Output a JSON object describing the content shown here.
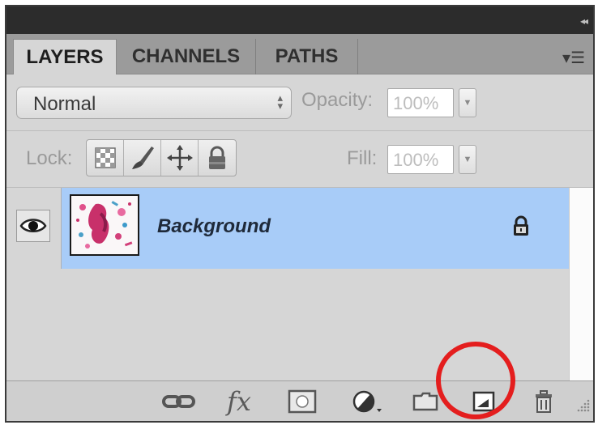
{
  "panel": {
    "tabs": [
      {
        "label": "LAYERS",
        "active": true
      },
      {
        "label": "CHANNELS",
        "active": false
      },
      {
        "label": "PATHS",
        "active": false
      }
    ]
  },
  "options": {
    "blend_mode": "Normal",
    "opacity_label": "Opacity:",
    "opacity_value": "100%",
    "lock_label": "Lock:",
    "fill_label": "Fill:",
    "fill_value": "100%"
  },
  "layers": [
    {
      "name": "Background",
      "visible": true,
      "locked": true,
      "selected": true
    }
  ],
  "footer": {
    "icons": [
      "link-layers-icon",
      "fx-layer-style-icon",
      "add-mask-icon",
      "adjustment-layer-icon",
      "new-group-folder-icon",
      "new-layer-icon",
      "delete-trash-icon"
    ],
    "highlighted_icon": "new-layer-icon"
  },
  "colors": {
    "selected_row": "#a8ccf8",
    "highlight_circle": "#e41e1e",
    "panel_bg": "#d6d6d6",
    "title_bar": "#2c2c2c"
  }
}
